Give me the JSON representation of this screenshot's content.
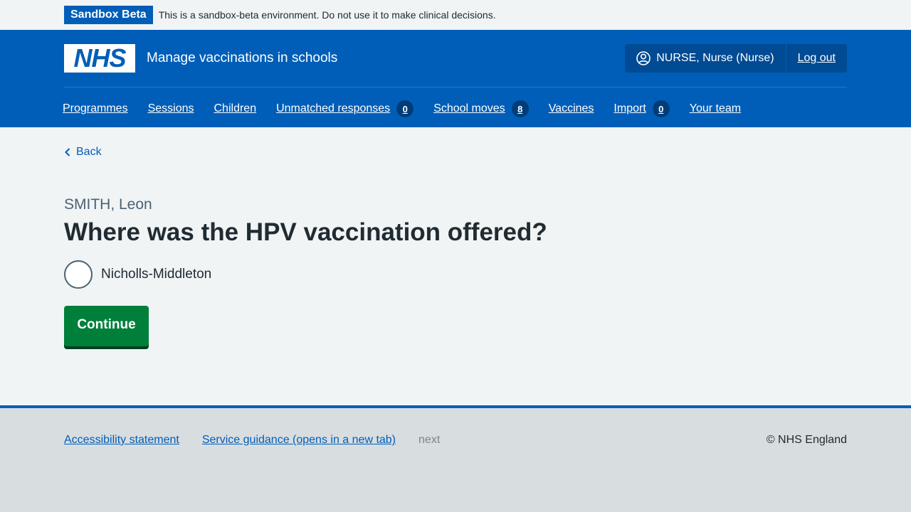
{
  "phase_banner": {
    "tag": "Sandbox Beta",
    "text": "This is a sandbox-beta environment. Do not use it to make clinical decisions."
  },
  "header": {
    "logo_text": "NHS",
    "service_name": "Manage vaccinations in schools",
    "user_name": "NURSE, Nurse (Nurse)",
    "user_icon": "user-circle-icon",
    "logout_label": "Log out",
    "nav": [
      {
        "label": "Programmes"
      },
      {
        "label": "Sessions"
      },
      {
        "label": "Children"
      },
      {
        "label": "Unmatched responses",
        "count": "0"
      },
      {
        "label": "School moves",
        "count": "8"
      },
      {
        "label": "Vaccines"
      },
      {
        "label": "Import",
        "count": "0"
      },
      {
        "label": "Your team"
      }
    ]
  },
  "main": {
    "back_label": "Back",
    "caption": "SMITH, Leon",
    "heading": "Where was the HPV vaccination offered?",
    "options": [
      {
        "label": "Nicholls-Middleton",
        "selected": false
      }
    ],
    "continue_label": "Continue"
  },
  "footer": {
    "links": [
      "Accessibility statement",
      "Service guidance (opens in a new tab)"
    ],
    "muted": "next",
    "copyright": "© NHS England"
  },
  "colors": {
    "nhs_blue": "#005eb8",
    "button_green": "#007f3b",
    "text": "#212b32",
    "secondary_text": "#4c6272"
  }
}
